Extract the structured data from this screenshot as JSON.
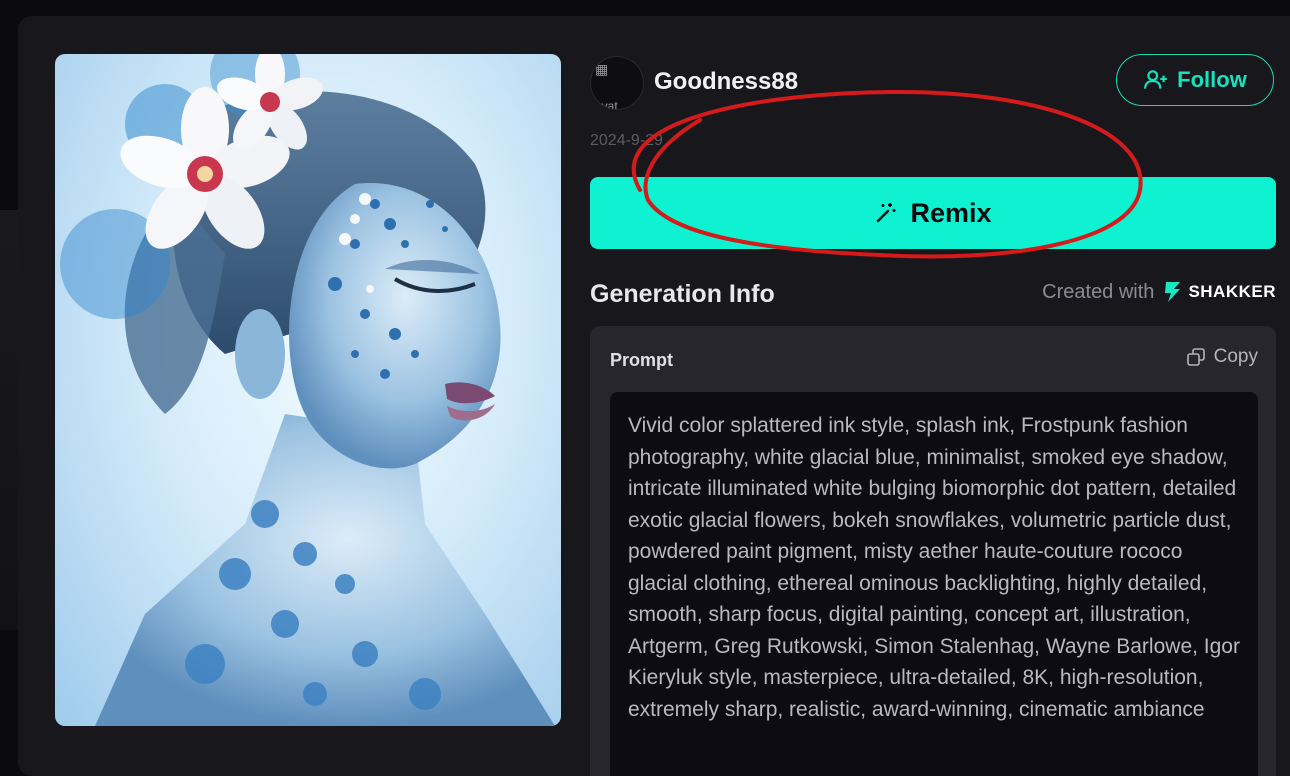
{
  "author": {
    "username": "Goodness88",
    "avatar_alt": "avat",
    "date": "2024-9-29"
  },
  "actions": {
    "follow_label": "Follow",
    "follow_icon": "user-plus-icon",
    "remix_label": "Remix",
    "remix_icon": "magic-wand-icon"
  },
  "generation": {
    "title": "Generation Info",
    "created_with": "Created with",
    "brand_name": "SHAKKER",
    "prompt_label": "Prompt",
    "copy_label": "Copy",
    "copy_icon": "copy-icon",
    "prompt_text": "Vivid color splattered ink style, splash ink, Frostpunk fashion photography, white glacial blue, minimalist, smoked eye shadow, intricate illuminated white bulging biomorphic dot pattern, detailed exotic glacial flowers, bokeh snowflakes, volumetric particle dust, powdered paint pigment, misty aether haute-couture rococo glacial clothing, ethereal ominous backlighting, highly detailed, smooth, sharp focus, digital painting, concept art, illustration, Artgerm, Greg Rutkowski, Simon Stalenhag, Wayne Barlowe, Igor Kieryluk style, masterpiece, ultra-detailed, 8K, high-resolution, extremely sharp, realistic, award-winning, cinematic ambiance"
  },
  "colors": {
    "accent": "#0ff2d1",
    "follow_border": "#19d9b5",
    "annotation": "#d41a1a",
    "modal_bg": "#18181c"
  }
}
